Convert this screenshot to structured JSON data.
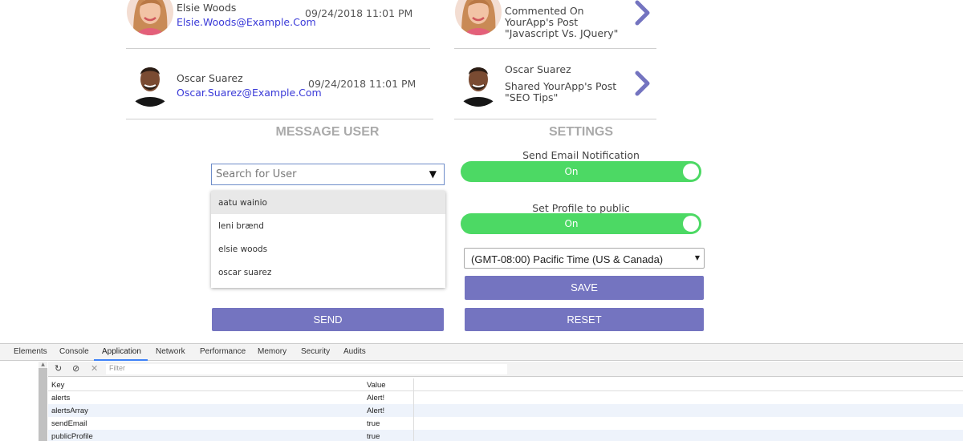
{
  "members": [
    {
      "name": "Elsie Woods",
      "email": "Elsie.Woods@Example.Com",
      "time": "09/24/2018 11:01 PM"
    },
    {
      "name": "Oscar Suarez",
      "email": "Oscar.Suarez@Example.Com",
      "time": "09/24/2018 11:01 PM"
    }
  ],
  "activity": [
    {
      "text": "Commented On YourApp's Post \"Javascript Vs. JQuery\""
    },
    {
      "name": "Oscar Suarez",
      "text": "Shared YourApp's Post \"SEO Tips\""
    }
  ],
  "message_user": {
    "title": "MESSAGE USER",
    "search_placeholder": "Search for User",
    "caret": "▼",
    "options": [
      "aatu wainio",
      "leni brænd",
      "elsie woods",
      "oscar suarez"
    ],
    "send_label": "SEND"
  },
  "settings": {
    "title": "SETTINGS",
    "email_notification_label": "Send Email Notification",
    "email_notification_state": "On",
    "public_profile_label": "Set Profile to public",
    "public_profile_state": "On",
    "timezone": "(GMT-08:00) Pacific Time (US & Canada)",
    "save_label": "SAVE",
    "reset_label": "RESET"
  },
  "colors": {
    "accent": "#7474c0",
    "toggle_on": "#4cd964",
    "link": "#3a3ad8"
  },
  "devtools": {
    "tabs": [
      "Elements",
      "Console",
      "Application",
      "Network",
      "Performance",
      "Memory",
      "Security",
      "Audits"
    ],
    "active_tab": "Application",
    "filter_placeholder": "Filter",
    "columns": [
      "Key",
      "Value"
    ],
    "rows": [
      {
        "key": "alerts",
        "value": "Alert!"
      },
      {
        "key": "alertsArray",
        "value": "Alert!"
      },
      {
        "key": "sendEmail",
        "value": "true"
      },
      {
        "key": "publicProfile",
        "value": "true"
      }
    ]
  }
}
